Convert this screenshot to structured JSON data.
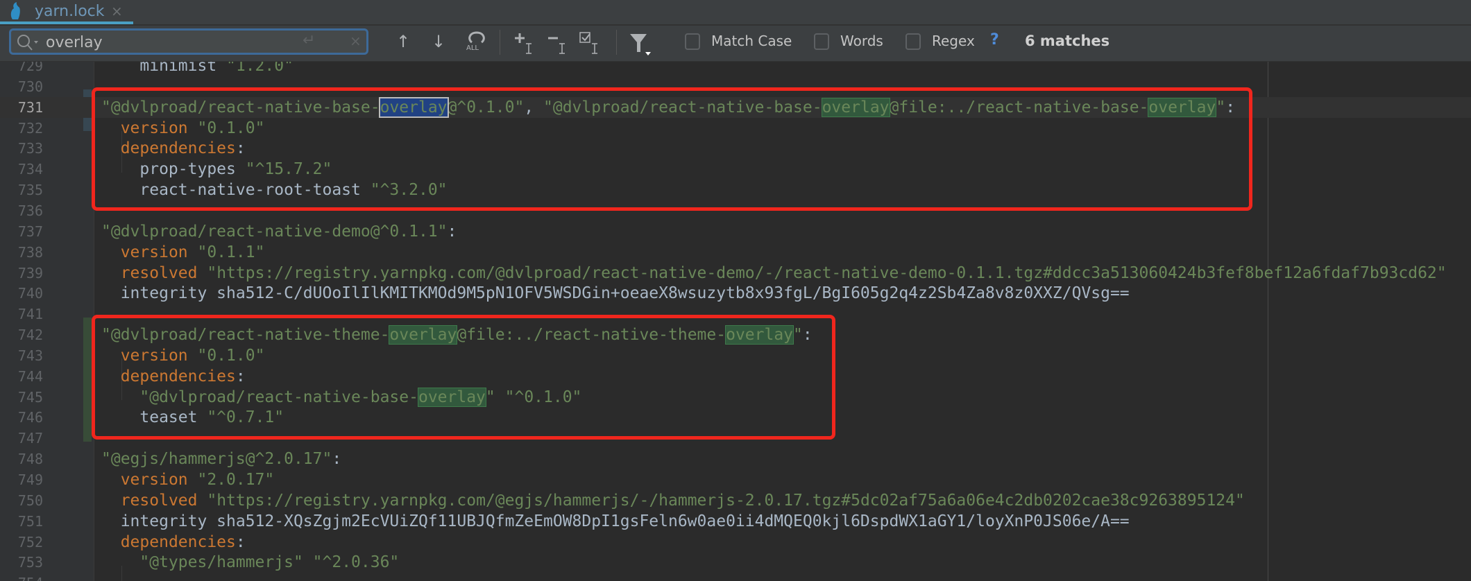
{
  "tab": {
    "title": "yarn.lock",
    "close": "×",
    "icon": "yarn-cat-icon"
  },
  "find": {
    "query": "overlay",
    "placeholder": "",
    "enter_symbol": "↵",
    "clear_symbol": "×",
    "prev": "↑",
    "next": "↓",
    "select_all": "ALL",
    "options": [
      {
        "label": "Match Case",
        "checked": false
      },
      {
        "label": "Words",
        "checked": false
      },
      {
        "label": "Regex",
        "checked": false
      }
    ],
    "help": "?",
    "result": "6 matches"
  },
  "colors": {
    "string": "#6a8759",
    "keyword": "#cc7832",
    "plain": "#a9b7c6",
    "match_bg": "#32593d",
    "selected_match_bg": "#214283",
    "annotation_box": "#f0261d",
    "accent": "#4a9fc4"
  },
  "current_line": 731,
  "lines": [
    {
      "n": "729",
      "tokens": [
        [
          "p",
          "    minimist "
        ],
        [
          "s",
          "\"1.2.0\""
        ]
      ]
    },
    {
      "n": "730",
      "tokens": []
    },
    {
      "n": "731",
      "tokens": [
        [
          "s",
          "\"@dvlproad/react-native-base-"
        ],
        [
          "sel",
          "overlay"
        ],
        [
          "s",
          "@^0.1.0\""
        ],
        [
          "p",
          ", "
        ],
        [
          "s",
          "\"@dvlproad/react-native-base-"
        ],
        [
          "m",
          "overlay"
        ],
        [
          "s",
          "@file:../react-native-base-"
        ],
        [
          "m",
          "overlay"
        ],
        [
          "s",
          "\""
        ],
        [
          "p",
          ":"
        ]
      ]
    },
    {
      "n": "732",
      "tokens": [
        [
          "p",
          "  "
        ],
        [
          "k",
          "version"
        ],
        [
          "p",
          " "
        ],
        [
          "s",
          "\"0.1.0\""
        ]
      ]
    },
    {
      "n": "733",
      "tokens": [
        [
          "p",
          "  "
        ],
        [
          "k",
          "dependencies"
        ],
        [
          "p",
          ":"
        ]
      ]
    },
    {
      "n": "734",
      "tokens": [
        [
          "p",
          "    prop-types "
        ],
        [
          "s",
          "\"^15.7.2\""
        ]
      ]
    },
    {
      "n": "735",
      "tokens": [
        [
          "p",
          "    react-native-root-toast "
        ],
        [
          "s",
          "\"^3.2.0\""
        ]
      ]
    },
    {
      "n": "736",
      "tokens": []
    },
    {
      "n": "737",
      "tokens": [
        [
          "s",
          "\"@dvlproad/react-native-demo@^0.1.1\""
        ],
        [
          "p",
          ":"
        ]
      ]
    },
    {
      "n": "738",
      "tokens": [
        [
          "p",
          "  "
        ],
        [
          "k",
          "version"
        ],
        [
          "p",
          " "
        ],
        [
          "s",
          "\"0.1.1\""
        ]
      ]
    },
    {
      "n": "739",
      "tokens": [
        [
          "p",
          "  "
        ],
        [
          "k",
          "resolved"
        ],
        [
          "p",
          " "
        ],
        [
          "s",
          "\"https://registry.yarnpkg.com/@dvlproad/react-native-demo/-/react-native-demo-0.1.1.tgz#ddcc3a513060424b3fef8bef12a6fdaf7b93cd62\""
        ]
      ]
    },
    {
      "n": "740",
      "tokens": [
        [
          "p",
          "  integrity sha512-C/dUOoIlIlKMITKMOd9M5pN1OFV5WSDGin+oeaeX8wsuzytb8x93fgL/BgI605g2q4z2Sb4Za8v8z0XXZ/QVsg=="
        ]
      ]
    },
    {
      "n": "741",
      "tokens": []
    },
    {
      "n": "742",
      "tokens": [
        [
          "s",
          "\"@dvlproad/react-native-theme-"
        ],
        [
          "m",
          "overlay"
        ],
        [
          "s",
          "@file:../react-native-theme-"
        ],
        [
          "m",
          "overlay"
        ],
        [
          "s",
          "\""
        ],
        [
          "p",
          ":"
        ]
      ]
    },
    {
      "n": "743",
      "tokens": [
        [
          "p",
          "  "
        ],
        [
          "k",
          "version"
        ],
        [
          "p",
          " "
        ],
        [
          "s",
          "\"0.1.0\""
        ]
      ]
    },
    {
      "n": "744",
      "tokens": [
        [
          "p",
          "  "
        ],
        [
          "k",
          "dependencies"
        ],
        [
          "p",
          ":"
        ]
      ]
    },
    {
      "n": "745",
      "tokens": [
        [
          "p",
          "    "
        ],
        [
          "s",
          "\"@dvlproad/react-native-base-"
        ],
        [
          "m",
          "overlay"
        ],
        [
          "s",
          "\""
        ],
        [
          "p",
          " "
        ],
        [
          "s",
          "\"^0.1.0\""
        ]
      ]
    },
    {
      "n": "746",
      "tokens": [
        [
          "p",
          "    teaset "
        ],
        [
          "s",
          "\"^0.7.1\""
        ]
      ]
    },
    {
      "n": "747",
      "tokens": []
    },
    {
      "n": "748",
      "tokens": [
        [
          "s",
          "\"@egjs/hammerjs@^2.0.17\""
        ],
        [
          "p",
          ":"
        ]
      ]
    },
    {
      "n": "749",
      "tokens": [
        [
          "p",
          "  "
        ],
        [
          "k",
          "version"
        ],
        [
          "p",
          " "
        ],
        [
          "s",
          "\"2.0.17\""
        ]
      ]
    },
    {
      "n": "750",
      "tokens": [
        [
          "p",
          "  "
        ],
        [
          "k",
          "resolved"
        ],
        [
          "p",
          " "
        ],
        [
          "s",
          "\"https://registry.yarnpkg.com/@egjs/hammerjs/-/hammerjs-2.0.17.tgz#5dc02af75a6a06e4c2db0202cae38c9263895124\""
        ]
      ]
    },
    {
      "n": "751",
      "tokens": [
        [
          "p",
          "  integrity sha512-XQsZgjm2EcVUiZQf11UBJQfmZeEmOW8DpI1gsFeln6w0ae0ii4dMQEQ0kjl6DspdWX1aGY1/loyXnP0JS06e/A=="
        ]
      ]
    },
    {
      "n": "752",
      "tokens": [
        [
          "p",
          "  "
        ],
        [
          "k",
          "dependencies"
        ],
        [
          "p",
          ":"
        ]
      ]
    },
    {
      "n": "753",
      "tokens": [
        [
          "p",
          "    "
        ],
        [
          "s",
          "\"@types/hammerjs\""
        ],
        [
          "p",
          " "
        ],
        [
          "s",
          "\"^2.0.36\""
        ]
      ]
    },
    {
      "n": "754",
      "tokens": []
    }
  ]
}
